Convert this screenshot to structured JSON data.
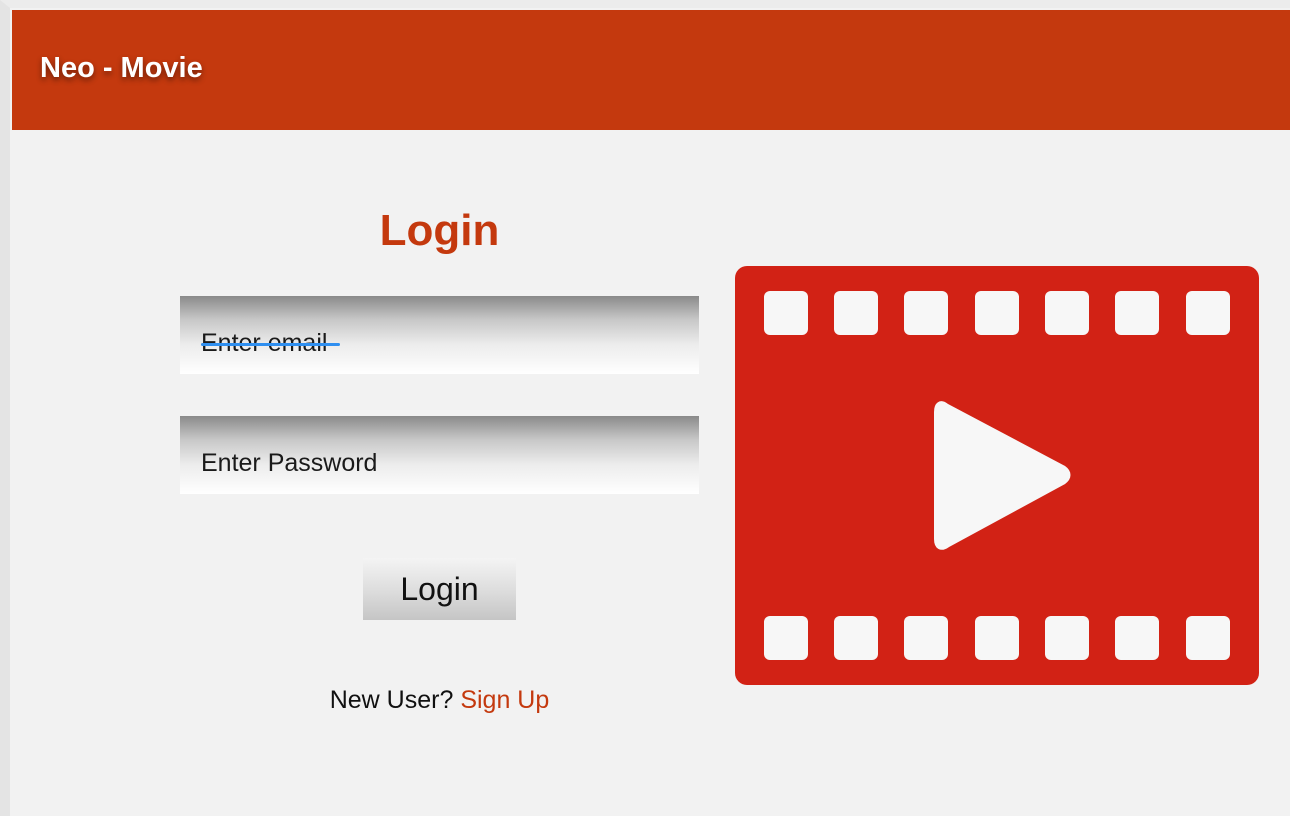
{
  "app": {
    "title": "Neo - Movie"
  },
  "login_form": {
    "heading": "Login",
    "email_placeholder": "Enter email",
    "password_placeholder": "Enter Password",
    "submit_label": "Login",
    "new_user_text": "New User?",
    "signup_link": "Sign Up"
  },
  "colors": {
    "primary": "#c4390e",
    "film_icon": "#d22215",
    "focus_underline": "#2f8ff0",
    "background": "#f2f2f2"
  },
  "illustration": {
    "icon": "film-play-icon"
  }
}
